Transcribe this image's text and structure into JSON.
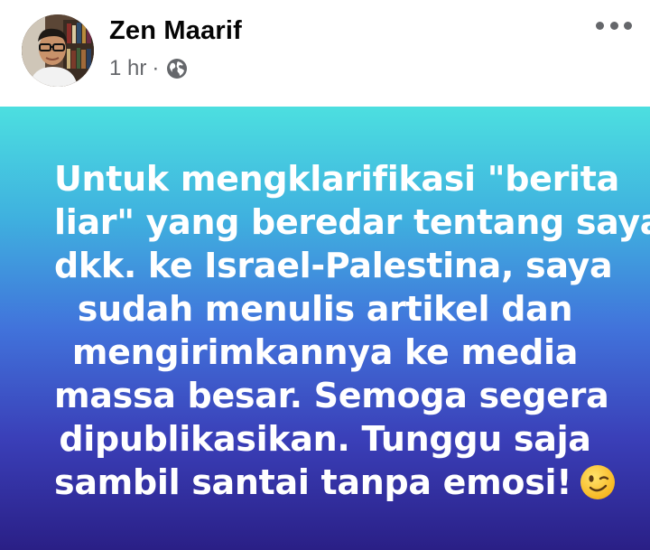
{
  "post": {
    "author": "Zen Maarif",
    "time": "1 hr",
    "separator": "·",
    "audience_icon": "globe-icon",
    "menu_icon": "more-horizontal-icon",
    "body_lines": [
      "Untuk mengklarifikasi \"berita",
      "liar\" yang beredar tentang saya",
      "dkk. ke Israel-Palestina, saya",
      "sudah menulis artikel dan",
      "mengirimkannya ke media",
      "massa besar. Semoga segera",
      "dipublikasikan. Tunggu saja",
      "sambil santai tanpa emosi!"
    ],
    "emoji": "winking-face-emoji",
    "gradient_colors": [
      "#4cdfe0",
      "#4173db",
      "#2a1f86"
    ]
  }
}
